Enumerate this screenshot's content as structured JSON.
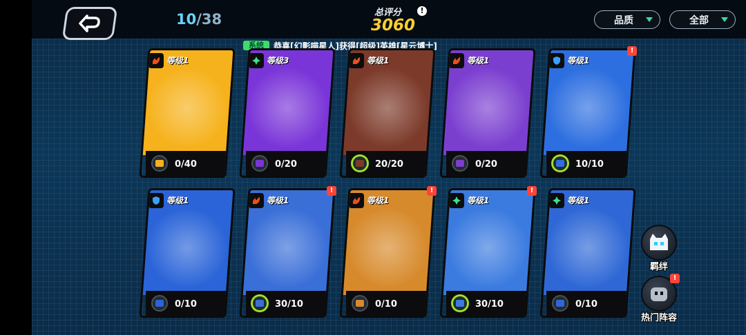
{
  "header": {
    "progress_current": "10",
    "progress_separator": "/",
    "progress_total": "38",
    "score_label": "总评分",
    "score_value": "3060",
    "info_glyph": "!",
    "filters": [
      {
        "label": "品质"
      },
      {
        "label": "全部"
      }
    ]
  },
  "ticker": {
    "tag": "系统",
    "message": "恭喜[幻影喵星人]获得[超级]英雄[星云博士]"
  },
  "cards": [
    {
      "level": "等级1",
      "count": "0/40",
      "element": "fire",
      "full": false,
      "bg": "#f6b21c",
      "alert": false
    },
    {
      "level": "等级3",
      "count": "0/20",
      "element": "nature",
      "full": false,
      "bg": "#7a35d8",
      "alert": false
    },
    {
      "level": "等级1",
      "count": "20/20",
      "element": "fire",
      "full": true,
      "bg": "#7c3a2a",
      "alert": false
    },
    {
      "level": "等级1",
      "count": "0/20",
      "element": "fire",
      "full": false,
      "bg": "#7b3fd0",
      "alert": false
    },
    {
      "level": "等级1",
      "count": "10/10",
      "element": "shield",
      "full": true,
      "bg": "#2d6fe0",
      "alert": true
    },
    {
      "level": "等级1",
      "count": "0/10",
      "element": "shield",
      "full": false,
      "bg": "#2a64d8",
      "alert": false
    },
    {
      "level": "等级1",
      "count": "30/10",
      "element": "fire",
      "full": true,
      "bg": "#3a6fd8",
      "alert": true
    },
    {
      "level": "等级1",
      "count": "0/10",
      "element": "fire",
      "full": false,
      "bg": "#d78a2c",
      "alert": true
    },
    {
      "level": "等级1",
      "count": "30/10",
      "element": "nature",
      "full": true,
      "bg": "#3b7be0",
      "alert": true
    },
    {
      "level": "等级1",
      "count": "0/10",
      "element": "nature",
      "full": false,
      "bg": "#2f68d6",
      "alert": false
    }
  ],
  "side_buttons": [
    {
      "label": "羁绊",
      "alert": false
    },
    {
      "label": "热门阵容",
      "alert": true
    }
  ],
  "alert_glyph": "!",
  "colors": {
    "progress_current": "#67d3ff",
    "score": "#ffcf2e",
    "system_tag": "#3edc6a",
    "alert": "#ff4438",
    "fire_element": "#e8501e",
    "nature_element": "#3ee08a",
    "shield_element": "#3aa0ff"
  }
}
